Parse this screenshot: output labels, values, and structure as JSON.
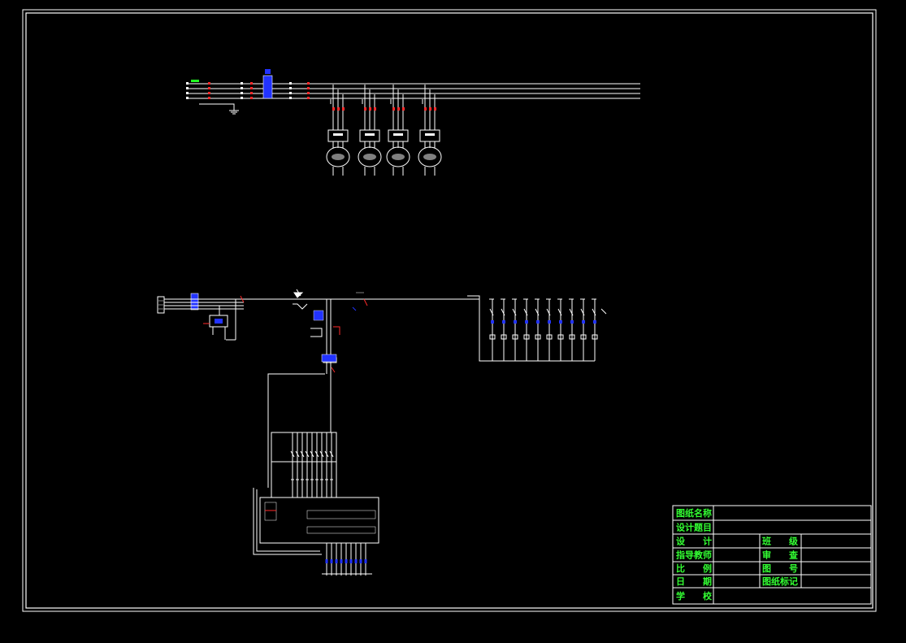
{
  "colors": {
    "background": "#000000",
    "line": "#ffffff",
    "accent_red": "#ff2a2a",
    "accent_blue": "#2233ff",
    "accent_green": "#22ff22",
    "titleblock_text": "#33ff33"
  },
  "title_block": {
    "rows": [
      {
        "left_label": "图纸名称",
        "right_label": "",
        "right_value": ""
      },
      {
        "left_label": "设计题目",
        "right_label": "",
        "right_value": ""
      },
      {
        "left_label": "设　　计",
        "right_label": "班　　级",
        "right_value": ""
      },
      {
        "left_label": "指导教师",
        "right_label": "审　　查",
        "right_value": ""
      },
      {
        "left_label": "比　　例",
        "right_label": "图　　号",
        "right_value": ""
      },
      {
        "left_label": "日　　期",
        "right_label": "图纸标记",
        "right_value": ""
      },
      {
        "left_label": "学　　校",
        "right_label": "",
        "right_value": ""
      }
    ]
  },
  "main_circuit": {
    "motor_count": 4,
    "bus_phase_count": 4
  },
  "control_circuit": {
    "output_branch_count": 10,
    "plc_input_count": 9,
    "plc_output_count": 9
  }
}
